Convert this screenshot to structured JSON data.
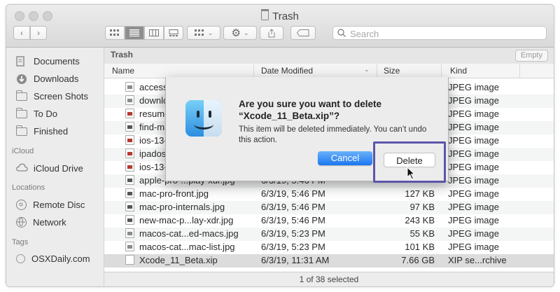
{
  "window": {
    "title": "Trash"
  },
  "toolbar": {
    "back_icon": "chevron-left-icon",
    "forward_icon": "chevron-right-icon",
    "view_icons": [
      "icon-view-icon",
      "list-view-icon",
      "column-view-icon",
      "gallery-view-icon"
    ],
    "group_icon": "group-icon",
    "action_icon": "gear-icon",
    "share_icon": "share-icon",
    "tag_icon": "tag-icon",
    "search_placeholder": "Search"
  },
  "sidebar": {
    "favorites": [
      {
        "label": "Documents",
        "icon": "documents-icon"
      },
      {
        "label": "Downloads",
        "icon": "downloads-icon"
      },
      {
        "label": "Screen Shots",
        "icon": "folder-icon"
      },
      {
        "label": "To Do",
        "icon": "folder-icon"
      },
      {
        "label": "Finished",
        "icon": "folder-icon"
      }
    ],
    "icloud_heading": "iCloud",
    "icloud": [
      {
        "label": "iCloud Drive",
        "icon": "cloud-icon"
      }
    ],
    "locations_heading": "Locations",
    "locations": [
      {
        "label": "Remote Disc",
        "icon": "disc-icon"
      },
      {
        "label": "Network",
        "icon": "network-icon"
      }
    ],
    "tags_heading": "Tags",
    "tags": [
      {
        "label": "OSXDaily.com",
        "icon": "tag-circle-icon"
      }
    ]
  },
  "pathbar": {
    "title": "Trash",
    "empty_button": "Empty"
  },
  "columns": {
    "name": "Name",
    "date": "Date Modified",
    "size": "Size",
    "kind": "Kind"
  },
  "files": [
    {
      "name": "access-",
      "date": "",
      "size": "",
      "kind": "JPEG image"
    },
    {
      "name": "downloa",
      "date": "",
      "size": "",
      "kind": "JPEG image"
    },
    {
      "name": "resume",
      "date": "",
      "size": "",
      "kind": "JPEG image"
    },
    {
      "name": "find-ma",
      "date": "",
      "size": "",
      "kind": "JPEG image"
    },
    {
      "name": "ios-13-",
      "date": "",
      "size": "",
      "kind": "JPEG image"
    },
    {
      "name": "ipados-",
      "date": "",
      "size": "",
      "kind": "JPEG image"
    },
    {
      "name": "ios-13-",
      "date": "",
      "size": "",
      "kind": "JPEG image"
    },
    {
      "name": "apple-pro-...play-xdr.jpg",
      "date": "6/3/19, 5:46 PM",
      "size": "",
      "kind": "JPEG image"
    },
    {
      "name": "mac-pro-front.jpg",
      "date": "6/3/19, 5:46 PM",
      "size": "127 KB",
      "kind": "JPEG image"
    },
    {
      "name": "mac-pro-internals.jpg",
      "date": "6/3/19, 5:46 PM",
      "size": "97 KB",
      "kind": "JPEG image"
    },
    {
      "name": "new-mac-p...lay-xdr.jpg",
      "date": "6/3/19, 5:46 PM",
      "size": "243 KB",
      "kind": "JPEG image"
    },
    {
      "name": "macos-cat...ed-macs.jpg",
      "date": "6/3/19, 5:23 PM",
      "size": "55 KB",
      "kind": "JPEG image"
    },
    {
      "name": "macos-cat...mac-list.jpg",
      "date": "6/3/19, 5:23 PM",
      "size": "101 KB",
      "kind": "JPEG image"
    },
    {
      "name": "Xcode_11_Beta.xip",
      "date": "6/3/19, 11:31 AM",
      "size": "7.66 GB",
      "kind": "XIP se...rchive"
    }
  ],
  "status": "1 of 38 selected",
  "dialog": {
    "title": "Are you sure you want to delete “Xcode_11_Beta.xip”?",
    "message": "This item will be deleted immediately. You can’t undo this action.",
    "cancel_label": "Cancel",
    "delete_label": "Delete",
    "icon": "finder-icon"
  },
  "colors": {
    "accent": "#1c77f2",
    "highlight_frame": "#5b56a9"
  }
}
